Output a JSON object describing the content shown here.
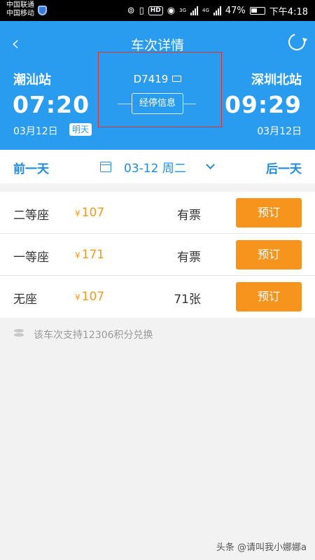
{
  "status_bar": {
    "carrier_1": "中国联通",
    "carrier_2": "中国移动",
    "network_1": "3G",
    "network_2": "4G",
    "battery": "47%",
    "time": "下午4:18"
  },
  "header": {
    "title": "车次详情",
    "departure": {
      "station": "潮汕站",
      "time": "07:20",
      "date": "03月12日",
      "tag": "明天"
    },
    "arrival": {
      "station": "深圳北站",
      "time": "09:29",
      "date": "03月12日"
    },
    "train_number": "D7419",
    "stops_button": "经停信息"
  },
  "date_nav": {
    "prev_label": "前一天",
    "current_date": "03-12 周二",
    "next_label": "后一天"
  },
  "seats": [
    {
      "name": "二等座",
      "currency": "¥",
      "price": "107",
      "availability": "有票",
      "button": "预订"
    },
    {
      "name": "一等座",
      "currency": "¥",
      "price": "171",
      "availability": "有票",
      "button": "预订"
    },
    {
      "name": "无座",
      "currency": "¥",
      "price": "107",
      "availability": "71张",
      "button": "预订"
    }
  ],
  "points_note": "该车次支持12306积分兑换",
  "watermark": "头条 @请叫我小娜娜a",
  "colors": {
    "header_blue": "#2a9cf0",
    "link_blue": "#1f8ce6",
    "price_orange": "#f39a1e",
    "button_orange": "#f7941d",
    "highlight_red": "#e03030"
  }
}
